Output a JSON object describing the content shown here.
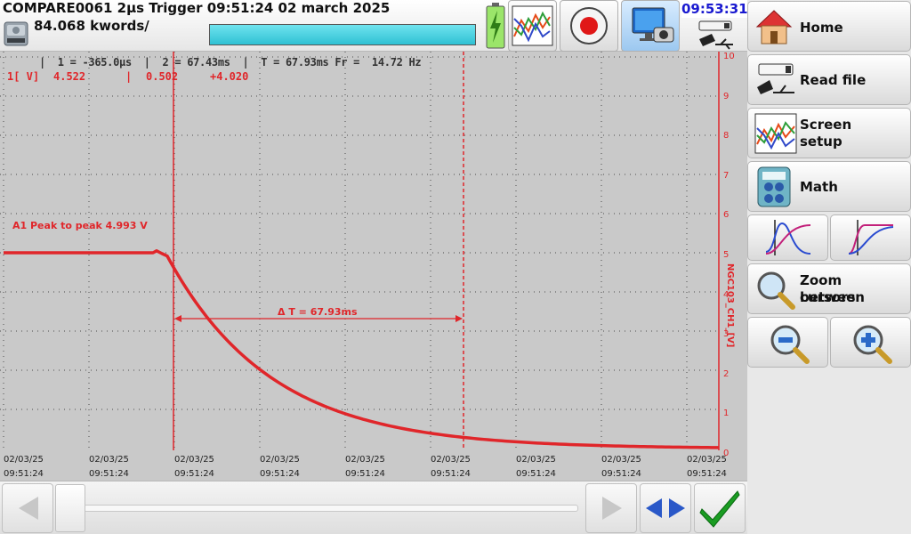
{
  "header": {
    "title": "COMPARE0061  2µs  Trigger 09:51:24 02 march 2025",
    "kwords": "84.068 kwords/",
    "progress_fraction": 1.0,
    "clock": "09:53:31"
  },
  "graph": {
    "cursor_info": "|  1 = -365.0µs  |  2 = 67.43ms  |  T = 67.93ms Fr =  14.72 Hz",
    "channel_label": "1[ V]",
    "value_cursor1": "4.522",
    "value_cursor2": "0.502",
    "value_delta": "+4.020",
    "peak_annotation": "A1 Peak to peak 4.993 V",
    "delta_annotation": "Δ T = 67.93ms",
    "y_axis_label": "NGC103_CH1_[V]",
    "y_ticks": [
      "10",
      "9",
      "8",
      "7",
      "6",
      "5",
      "4",
      "3",
      "2",
      "1",
      "0"
    ],
    "x_ticks": [
      {
        "date": "02/03/25",
        "time": "09:51:24"
      },
      {
        "date": "02/03/25",
        "time": "09:51:24"
      },
      {
        "date": "02/03/25",
        "time": "09:51:24"
      },
      {
        "date": "02/03/25",
        "time": "09:51:24"
      },
      {
        "date": "02/03/25",
        "time": "09:51:24"
      },
      {
        "date": "02/03/25",
        "time": "09:51:24"
      },
      {
        "date": "02/03/25",
        "time": "09:51:24"
      },
      {
        "date": "02/03/25",
        "time": "09:51:24"
      },
      {
        "date": "02/03/25",
        "time": "09:51:24"
      }
    ],
    "trace_color": "#e0262a"
  },
  "panel": {
    "home": "Home",
    "read_file": "Read file",
    "screen_setup_line1": "Screen",
    "screen_setup_line2": "setup",
    "math": "Math",
    "zoom_line1": "Zoom between",
    "zoom_line2": "cursors"
  }
}
